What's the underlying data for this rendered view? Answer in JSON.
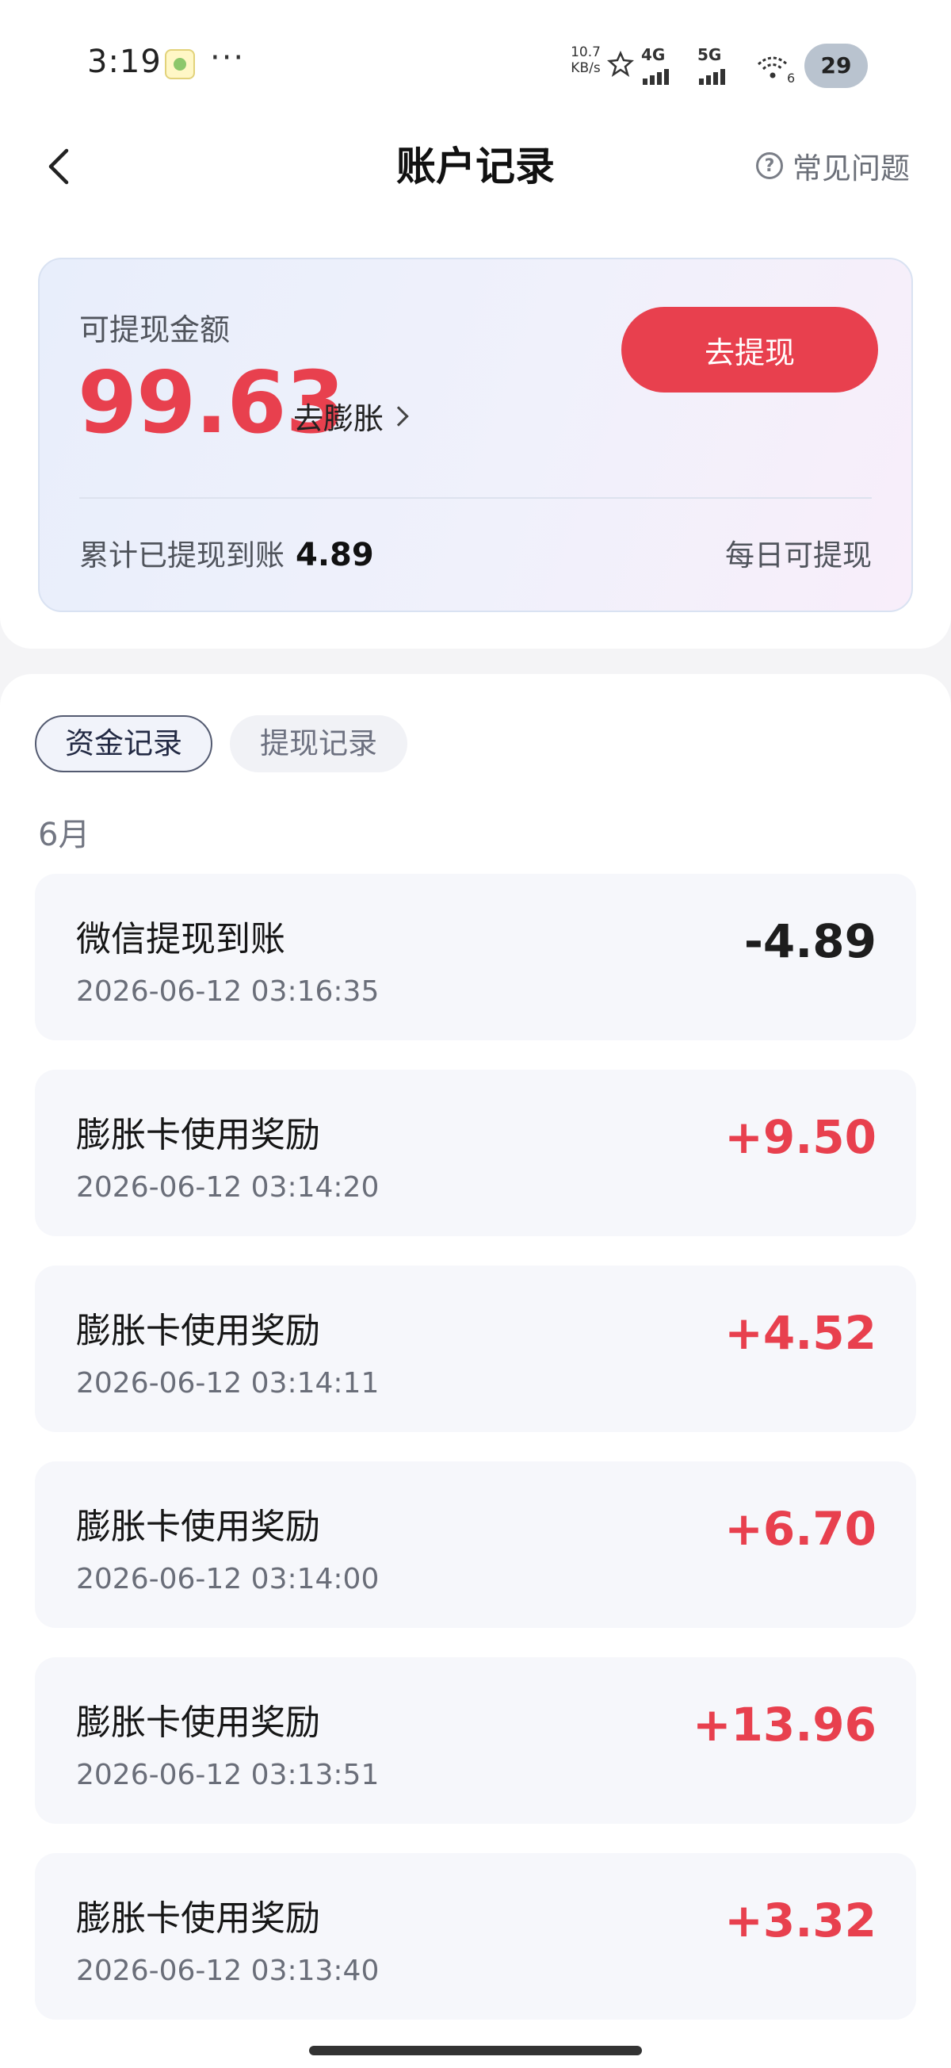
{
  "status_bar": {
    "time": "3:19",
    "speed_value": "10.7",
    "speed_unit": "KB/s",
    "net1": "4G",
    "net2": "5G",
    "wifi_sub": "6",
    "battery": "29"
  },
  "header": {
    "title": "账户记录",
    "faq_label": "常见问题"
  },
  "balance": {
    "label": "可提现金额",
    "amount": "99.63",
    "expand_label": "去膨胀",
    "withdraw_button": "去提现",
    "total_label": "累计已提现到账",
    "total_value": "4.89",
    "daily_note": "每日可提现"
  },
  "tabs": [
    {
      "label": "资金记录",
      "active": true
    },
    {
      "label": "提现记录",
      "active": false
    }
  ],
  "month": "6月",
  "records": [
    {
      "title": "微信提现到账",
      "time": "2026-06-12 03:16:35",
      "amount": "-4.89",
      "type": "neg"
    },
    {
      "title": "膨胀卡使用奖励",
      "time": "2026-06-12 03:14:20",
      "amount": "+9.50",
      "type": "pos"
    },
    {
      "title": "膨胀卡使用奖励",
      "time": "2026-06-12 03:14:11",
      "amount": "+4.52",
      "type": "pos"
    },
    {
      "title": "膨胀卡使用奖励",
      "time": "2026-06-12 03:14:00",
      "amount": "+6.70",
      "type": "pos"
    },
    {
      "title": "膨胀卡使用奖励",
      "time": "2026-06-12 03:13:51",
      "amount": "+13.96",
      "type": "pos"
    },
    {
      "title": "膨胀卡使用奖励",
      "time": "2026-06-12 03:13:40",
      "amount": "+3.32",
      "type": "pos"
    }
  ],
  "colors": {
    "accent_red": "#e8404e",
    "negative_text": "#1d1d1d"
  }
}
